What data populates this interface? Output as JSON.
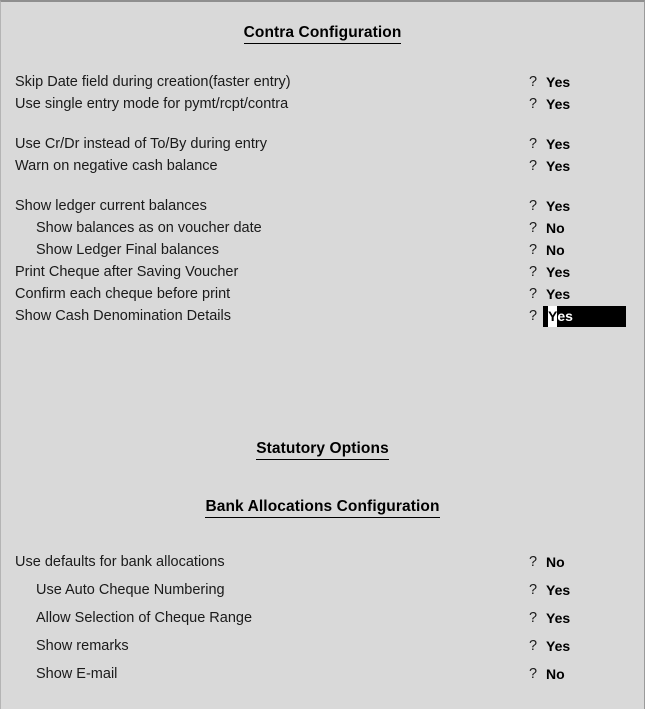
{
  "window": {
    "background_color": "#d9d9d9",
    "text_color": "#000000",
    "highlight_bg": "#000000",
    "highlight_fg": "#ffffff"
  },
  "sections": [
    {
      "id": "contra",
      "heading": "Contra Configuration",
      "options": [
        {
          "label": "Skip Date field during creation(faster entry)",
          "prompt": "?",
          "value": "Yes",
          "indent": false,
          "active": false
        },
        {
          "label": "Use single entry mode for pymt/rcpt/contra",
          "prompt": "?",
          "value": "Yes",
          "indent": false,
          "active": false
        },
        {
          "label": "Use Cr/Dr instead of To/By during entry",
          "prompt": "?",
          "value": "Yes",
          "indent": false,
          "active": false
        },
        {
          "label": "Warn on negative cash balance",
          "prompt": "?",
          "value": "Yes",
          "indent": false,
          "active": false
        },
        {
          "label": "Show ledger current balances",
          "prompt": "?",
          "value": "Yes",
          "indent": false,
          "active": false
        },
        {
          "label": "Show balances as on voucher date",
          "prompt": "?",
          "value": "No",
          "indent": true,
          "active": false
        },
        {
          "label": "Show Ledger Final balances",
          "prompt": "?",
          "value": "No",
          "indent": true,
          "active": false
        },
        {
          "label": "Print Cheque after Saving Voucher",
          "prompt": "?",
          "value": "Yes",
          "indent": false,
          "active": false
        },
        {
          "label": "Confirm each cheque before print",
          "prompt": "?",
          "value": "Yes",
          "indent": false,
          "active": false
        },
        {
          "label": "Show Cash Denomination Details",
          "prompt": "?",
          "value": "Yes",
          "indent": false,
          "active": true,
          "cursor_char": "Y",
          "value_rest": "es"
        }
      ]
    },
    {
      "id": "statutory",
      "heading": "Statutory Options",
      "options": []
    },
    {
      "id": "bank",
      "heading": "Bank Allocations Configuration",
      "options": [
        {
          "label": "Use defaults for bank allocations",
          "prompt": "?",
          "value": "No",
          "indent": false,
          "active": false
        },
        {
          "label": "Use Auto Cheque Numbering",
          "prompt": "?",
          "value": "Yes",
          "indent": true,
          "active": false
        },
        {
          "label": "Allow Selection of Cheque Range",
          "prompt": "?",
          "value": "Yes",
          "indent": true,
          "active": false
        },
        {
          "label": "Show remarks",
          "prompt": "?",
          "value": "Yes",
          "indent": true,
          "active": false
        },
        {
          "label": "Show E-mail",
          "prompt": "?",
          "value": "No",
          "indent": true,
          "active": false
        }
      ]
    }
  ]
}
